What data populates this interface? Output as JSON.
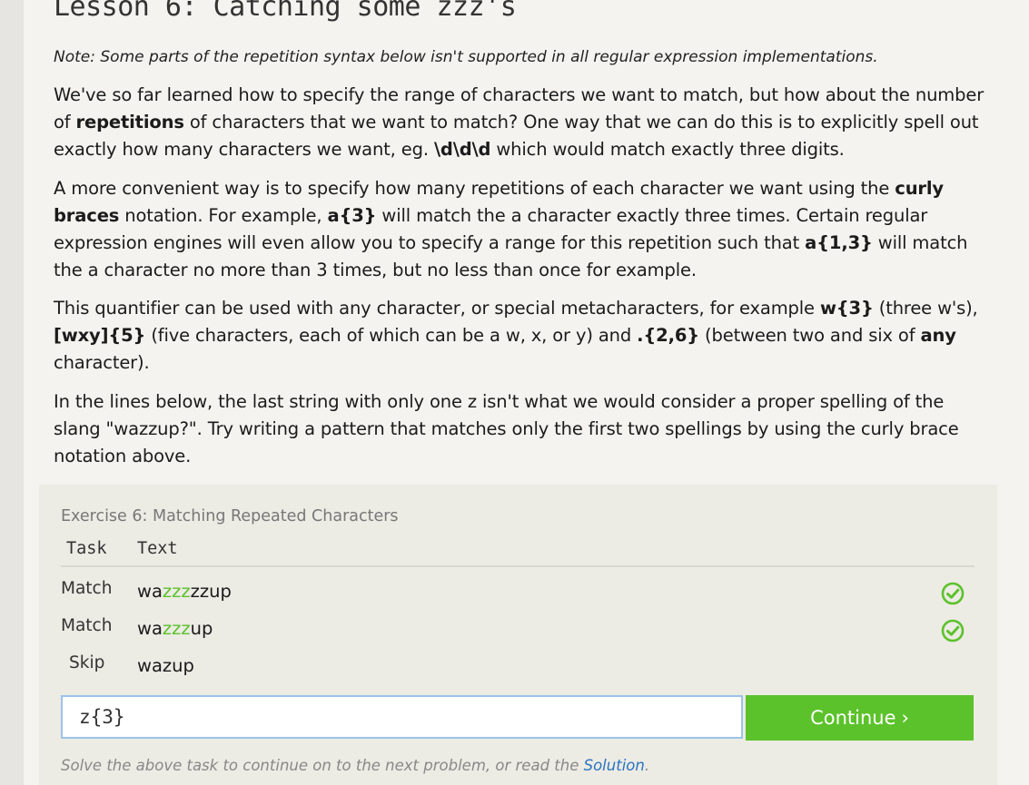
{
  "lesson": {
    "title": "Lesson 6: Catching some zzz's",
    "note": "Note: Some parts of the repetition syntax below isn't supported in all regular expression implementations."
  },
  "paragraphs": {
    "p1": {
      "a": "We've so far learned how to specify the range of characters we want to match, but how about the number of ",
      "b1": "repetitions",
      "c": " of characters that we want to match? One way that we can do this is to explicitly spell out exactly how many characters we want, eg. ",
      "b2": "\\d\\d\\d",
      "d": " which would match exactly three digits."
    },
    "p2": {
      "a": "A more convenient way is to specify how many repetitions of each character we want using the ",
      "b1": "curly braces",
      "c": " notation. For example, ",
      "b2": "a{3}",
      "d": " will match the a character exactly three times. Certain regular expression engines will even allow you to specify a range for this repetition such that ",
      "b3": "a{1,3}",
      "e": " will match the a character no more than 3 times, but no less than once for example."
    },
    "p3": {
      "a": "This quantifier can be used with any character, or special metacharacters, for example ",
      "b1": "w{3}",
      "c": " (three w's), ",
      "b2": "[wxy]{5}",
      "d": " (five characters, each of which can be a w, x, or y) and ",
      "b3": ".{2,6}",
      "e": " (between two and six of ",
      "b4": "any",
      "f": " character)."
    },
    "p4": {
      "a": "In the lines below, the last string with only one z isn't what we would consider a proper spelling of the slang \"wazzup?\". Try writing a pattern that matches only the first two spellings by using the curly brace notation above."
    }
  },
  "exercise": {
    "title": "Exercise 6: Matching Repeated Characters",
    "headers": {
      "task": "Task",
      "text": "Text"
    },
    "rows": [
      {
        "task": "Match",
        "pre": "wa",
        "highlight": "zzz",
        "post": "zzup",
        "status": "check-icon"
      },
      {
        "task": "Match",
        "pre": "wa",
        "highlight": "zzz",
        "post": "up",
        "status": "check-icon"
      },
      {
        "task": "Skip",
        "pre": "wazup",
        "highlight": "",
        "post": "",
        "status": ""
      }
    ],
    "input_value": "z{3}",
    "continue_label": "Continue",
    "continue_chevron": "›",
    "footer_text": "Solve the above task to continue on to the next problem, or read the ",
    "footer_link": "Solution",
    "footer_end": "."
  },
  "colors": {
    "accent_green": "#5cc22b",
    "link_blue": "#2a73c0",
    "input_border": "#9cc3e8"
  }
}
